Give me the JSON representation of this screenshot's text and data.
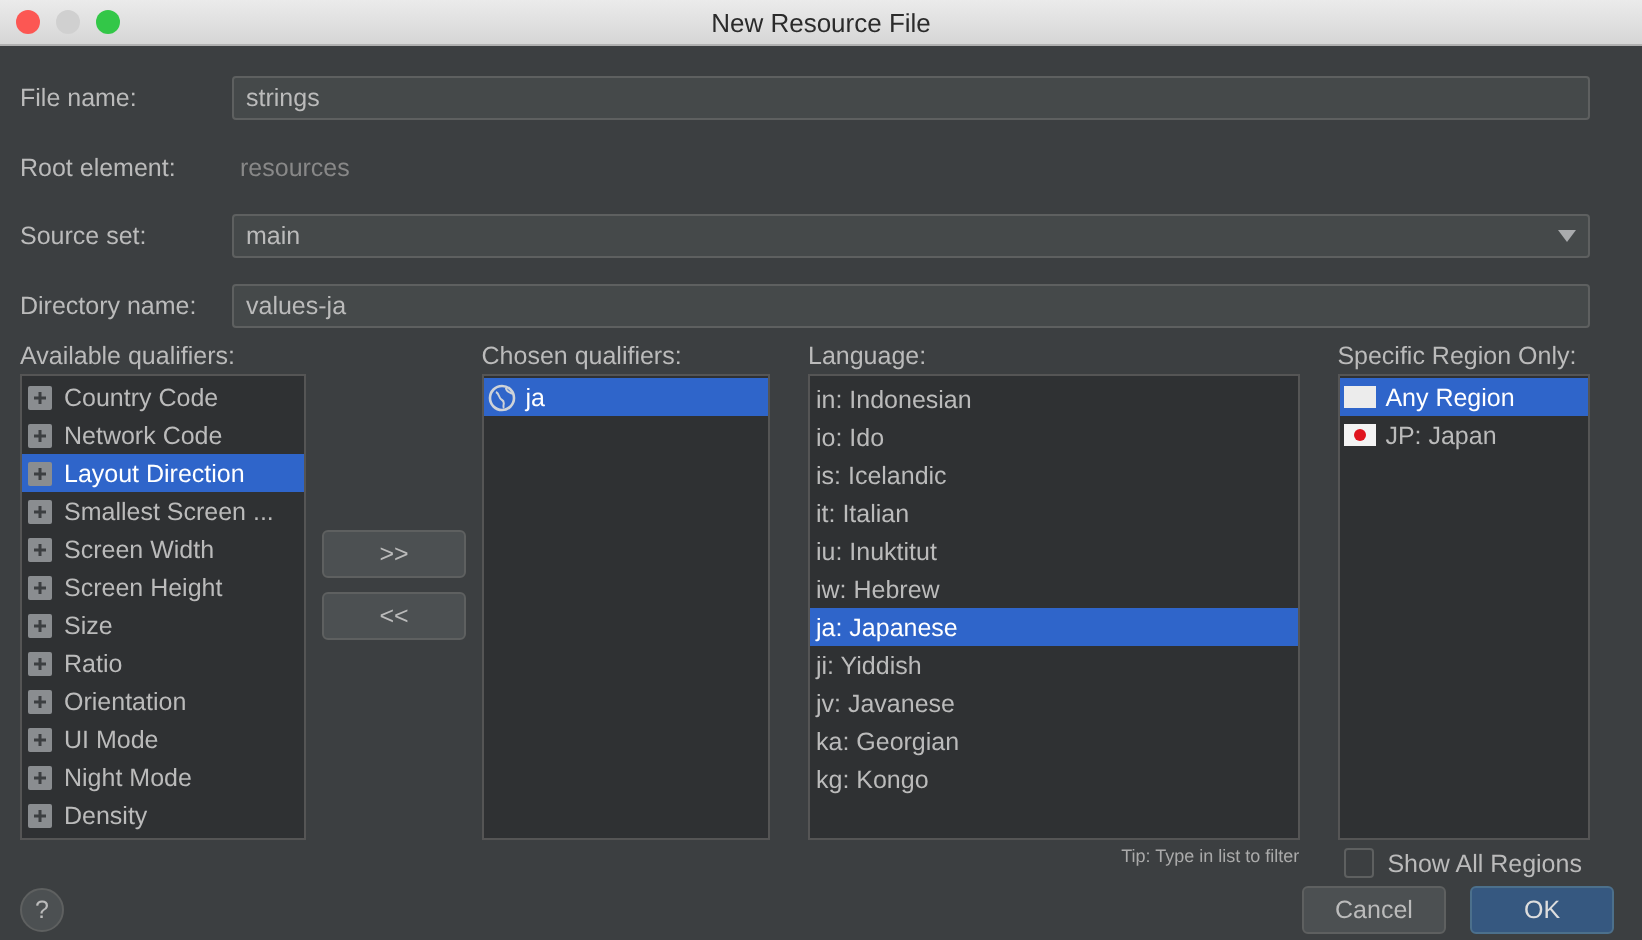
{
  "window": {
    "title": "New Resource File"
  },
  "fields": [
    {
      "label": "File name:",
      "kind": "text",
      "value": "strings"
    },
    {
      "label": "Root element:",
      "kind": "static",
      "value": "resources"
    },
    {
      "label": "Source set:",
      "kind": "dropdown",
      "value": "main"
    },
    {
      "label": "Directory name:",
      "kind": "text",
      "value": "values-ja"
    }
  ],
  "available_qualifiers": {
    "label": "Available qualifiers:",
    "items": [
      {
        "label": "Country Code",
        "selected": false
      },
      {
        "label": "Network Code",
        "selected": false
      },
      {
        "label": "Layout Direction",
        "selected": true
      },
      {
        "label": "Smallest Screen ...",
        "selected": false
      },
      {
        "label": "Screen Width",
        "selected": false
      },
      {
        "label": "Screen Height",
        "selected": false
      },
      {
        "label": "Size",
        "selected": false
      },
      {
        "label": "Ratio",
        "selected": false
      },
      {
        "label": "Orientation",
        "selected": false
      },
      {
        "label": "UI Mode",
        "selected": false
      },
      {
        "label": "Night Mode",
        "selected": false
      },
      {
        "label": "Density",
        "selected": false
      }
    ]
  },
  "move_buttons": [
    ">>",
    "<<"
  ],
  "chosen_qualifiers": {
    "label": "Chosen qualifiers:",
    "items": [
      {
        "label": "ja",
        "selected": true
      }
    ]
  },
  "language": {
    "label": "Language:",
    "items": [
      {
        "label": "in: Indonesian",
        "selected": false
      },
      {
        "label": "io: Ido",
        "selected": false
      },
      {
        "label": "is: Icelandic",
        "selected": false
      },
      {
        "label": "it: Italian",
        "selected": false
      },
      {
        "label": "iu: Inuktitut",
        "selected": false
      },
      {
        "label": "iw: Hebrew",
        "selected": false
      },
      {
        "label": "ja: Japanese",
        "selected": true
      },
      {
        "label": "ji: Yiddish",
        "selected": false
      },
      {
        "label": "jv: Javanese",
        "selected": false
      },
      {
        "label": "ka: Georgian",
        "selected": false
      },
      {
        "label": "kg: Kongo",
        "selected": false
      }
    ],
    "tip": "Tip: Type in list to filter"
  },
  "region": {
    "label": "Specific Region Only:",
    "items": [
      {
        "label": "Any Region",
        "selected": true,
        "kind": "blank"
      },
      {
        "label": "JP: Japan",
        "selected": false,
        "kind": "japan"
      }
    ],
    "show_all": {
      "label": "Show All Regions",
      "checked": false
    }
  },
  "help": "?",
  "buttons": [
    {
      "label": "Cancel",
      "primary": false
    },
    {
      "label": "OK",
      "primary": true
    }
  ]
}
